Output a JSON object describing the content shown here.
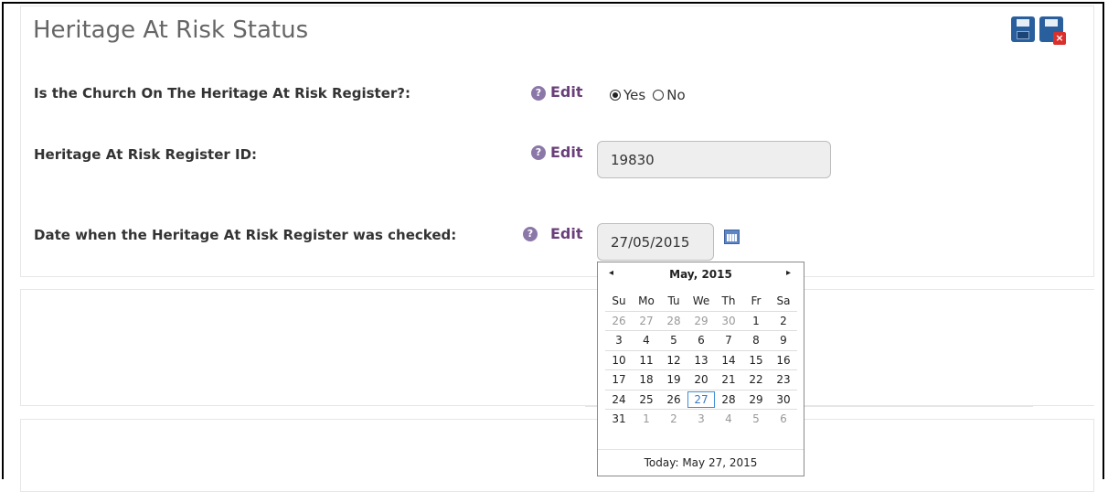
{
  "section": {
    "title": "Heritage At Risk Status",
    "actions": {
      "save_icon": "save-disk-icon",
      "cancel_icon": "cancel-disk-icon"
    }
  },
  "fields": {
    "on_register": {
      "label": "Is the Church On The Heritage At Risk Register?:",
      "edit": "Edit",
      "options": [
        "Yes",
        "No"
      ],
      "selected": "Yes"
    },
    "register_id": {
      "label": "Heritage At Risk Register ID:",
      "edit": "Edit",
      "value": "19830"
    },
    "date_checked": {
      "label": "Date when the Heritage At Risk Register was checked:",
      "edit": "Edit",
      "value": "27/05/2015"
    }
  },
  "help_glyph": "?",
  "datepicker": {
    "prev": "◂",
    "next": "▸",
    "title": "May, 2015",
    "weekdays": [
      "Su",
      "Mo",
      "Tu",
      "We",
      "Th",
      "Fr",
      "Sa"
    ],
    "weeks": [
      [
        "26",
        "27",
        "28",
        "29",
        "30",
        "1",
        "2"
      ],
      [
        "3",
        "4",
        "5",
        "6",
        "7",
        "8",
        "9"
      ],
      [
        "10",
        "11",
        "12",
        "13",
        "14",
        "15",
        "16"
      ],
      [
        "17",
        "18",
        "19",
        "20",
        "21",
        "22",
        "23"
      ],
      [
        "24",
        "25",
        "26",
        "27",
        "28",
        "29",
        "30"
      ],
      [
        "31",
        "1",
        "2",
        "3",
        "4",
        "5",
        "6"
      ]
    ],
    "selected_day": "27",
    "today_text": "Today: May 27, 2015"
  }
}
